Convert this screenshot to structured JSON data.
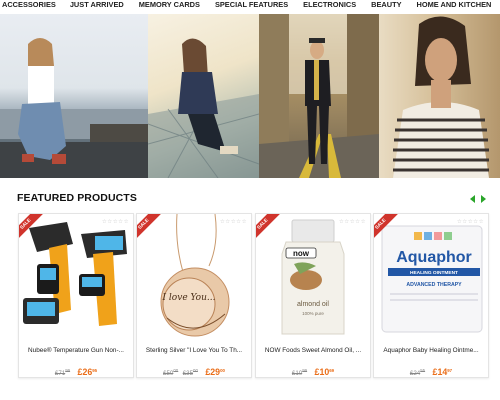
{
  "nav": {
    "items": [
      "ACCESSORIES",
      "JUST ARRIVED",
      "MEMORY CARDS",
      "SPECIAL FEATURES",
      "ELECTRONICS",
      "BEAUTY",
      "HOME AND KITCHEN"
    ]
  },
  "featured": {
    "title": "FEATURED PRODUCTS",
    "products": [
      {
        "badge": "SALE",
        "name": "Nubee® Temperature Gun Non-...",
        "old_whole": "£71",
        "old_frac": "99",
        "new_whole": "£26",
        "new_frac": "95"
      },
      {
        "badge": "SALE",
        "name": "Sterling Silver \"I Love You To Th...",
        "old_whole": "£50",
        "old_frac": "00",
        "old2_whole": "£35",
        "old2_frac": "00",
        "new_whole": "£29",
        "new_frac": "00",
        "pendant_text": "I love You..."
      },
      {
        "badge": "SALE",
        "name": "NOW Foods Sweet Almond Oil, ...",
        "old_whole": "£10",
        "old_frac": "99",
        "new_whole": "£10",
        "new_frac": "69",
        "brand": "now",
        "label_line1": "almond oil",
        "label_line2": "100% pure"
      },
      {
        "badge": "SALE",
        "name": "Aquaphor Baby Healing Ointme...",
        "old_whole": "£24",
        "old_frac": "55",
        "new_whole": "£14",
        "new_frac": "97",
        "brand": "Aquaphor",
        "label_line1": "HEALING OINTMENT",
        "label_line2": "ADVANCED THERAPY"
      }
    ]
  },
  "colors": {
    "accent_green": "#2aa52a",
    "sale_red": "#d0342c",
    "price_orange": "#ea6d18"
  }
}
